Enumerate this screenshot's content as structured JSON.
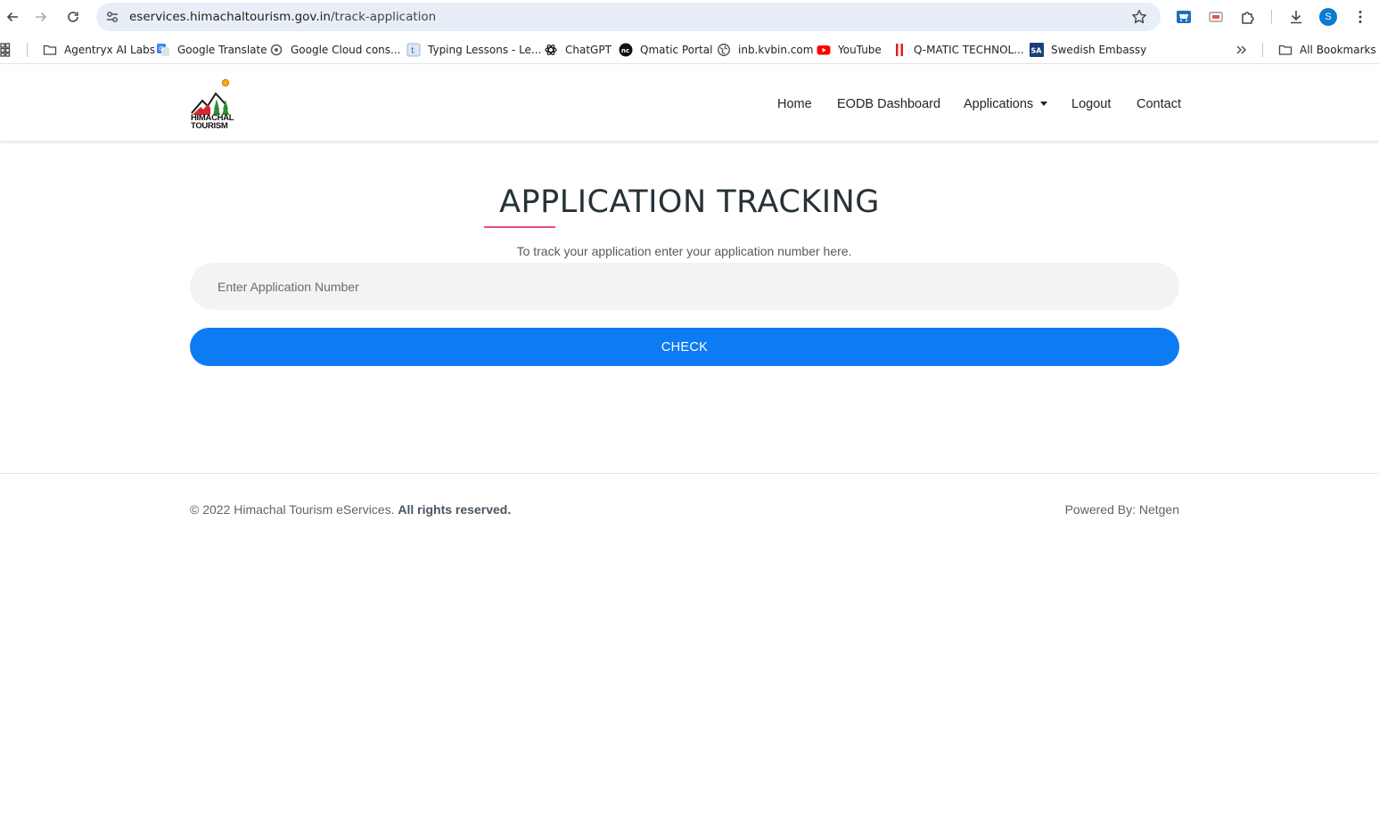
{
  "browser": {
    "url_host": "eservices.himachaltourism.gov.in",
    "url_path": "/track-application",
    "profile_initial": "S",
    "bookmarks": [
      {
        "label": "Agentryx AI Labs",
        "icon": "folder-icon"
      },
      {
        "label": "Google Translate",
        "icon": "google-translate-icon"
      },
      {
        "label": "Google Cloud cons...",
        "icon": "google-cloud-icon"
      },
      {
        "label": "Typing Lessons - Le...",
        "icon": "typing-icon"
      },
      {
        "label": "ChatGPT",
        "icon": "chatgpt-icon"
      },
      {
        "label": "Qmatic Portal",
        "icon": "qmatic-icon"
      },
      {
        "label": "inb.kvbin.com",
        "icon": "globe-icon"
      },
      {
        "label": "YouTube",
        "icon": "youtube-icon"
      },
      {
        "label": "Q-MATIC TECHNOL...",
        "icon": "qmatic-tech-icon"
      },
      {
        "label": "Swedish Embassy",
        "icon": "swedish-embassy-icon"
      }
    ],
    "all_bookmarks_label": "All Bookmarks"
  },
  "site": {
    "logo_text_line1": "HIMACHAL",
    "logo_text_line2": "TOURISM",
    "nav": {
      "home": "Home",
      "eodb": "EODB Dashboard",
      "applications": "Applications",
      "logout": "Logout",
      "contact": "Contact"
    }
  },
  "main": {
    "title": "APPLICATION TRACKING",
    "subtitle": "To track your application enter your application number here.",
    "input_placeholder": "Enter Application Number",
    "input_value": "",
    "check_label": "CHECK"
  },
  "footer": {
    "copyright": "© 2022 Himachal Tourism eServices.",
    "rights": "All rights reserved.",
    "powered_by": "Powered By: Netgen"
  },
  "colors": {
    "accent_blue": "#0d7cf2",
    "underline_pink": "#e8507a",
    "omnibox_bg": "#e8eef7",
    "avatar_blue": "#0b7bd0"
  }
}
